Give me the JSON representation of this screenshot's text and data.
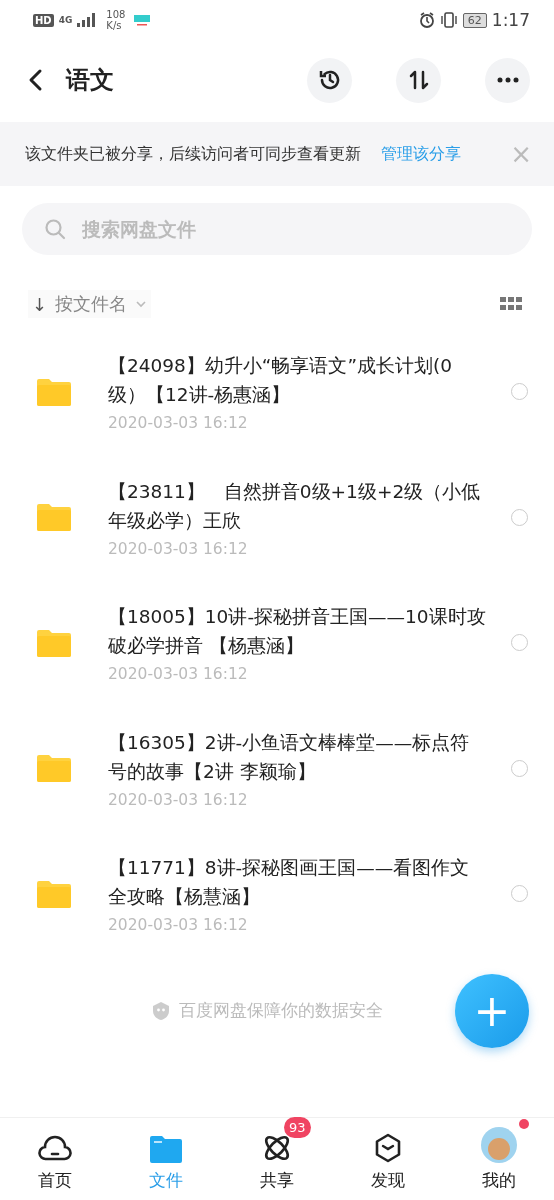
{
  "status_bar": {
    "hd": "HD",
    "network": "4G",
    "speed": "108",
    "speed_unit": "K/s",
    "battery": "62",
    "time": "1:17"
  },
  "header": {
    "title": "语文"
  },
  "share_notice": {
    "text": "该文件夹已被分享，后续访问者可同步查看更新",
    "link": "管理该分享",
    "close": "×"
  },
  "search": {
    "placeholder": "搜索网盘文件"
  },
  "sort": {
    "arrow": "↓",
    "label": "按文件名"
  },
  "files": [
    {
      "name": "【24098】幼升小“畅享语文”成长计划(0级）【12讲-杨惠涵】",
      "date": "2020-03-03  16:12",
      "selected": false
    },
    {
      "name": "【23811】　自然拼音0级+1级+2级（小低年级必学）王欣",
      "date": "2020-03-03  16:12",
      "selected": false
    },
    {
      "name": "【18005】10讲-探秘拼音王国——10课时攻破必学拼音 【杨惠涵】",
      "date": "2020-03-03  16:12",
      "selected": false
    },
    {
      "name": "【16305】2讲-小鱼语文棒棒堂——标点符号的故事【2讲 李颖瑜】",
      "date": "2020-03-03  16:12",
      "selected": false
    },
    {
      "name": "【11771】8讲-探秘图画王国——看图作文全攻略【杨慧涵】",
      "date": "2020-03-03  16:12",
      "selected": false
    }
  ],
  "footer_note": "百度网盘保障你的数据安全",
  "fab": "+",
  "nav": [
    {
      "kind": "home",
      "label": "首页",
      "selected": false
    },
    {
      "kind": "files",
      "label": "文件",
      "selected": true
    },
    {
      "kind": "share",
      "label": "共享",
      "selected": false,
      "badge": "93"
    },
    {
      "kind": "discover",
      "label": "发现",
      "selected": false
    },
    {
      "kind": "me",
      "label": "我的",
      "selected": false,
      "dot": true
    }
  ]
}
